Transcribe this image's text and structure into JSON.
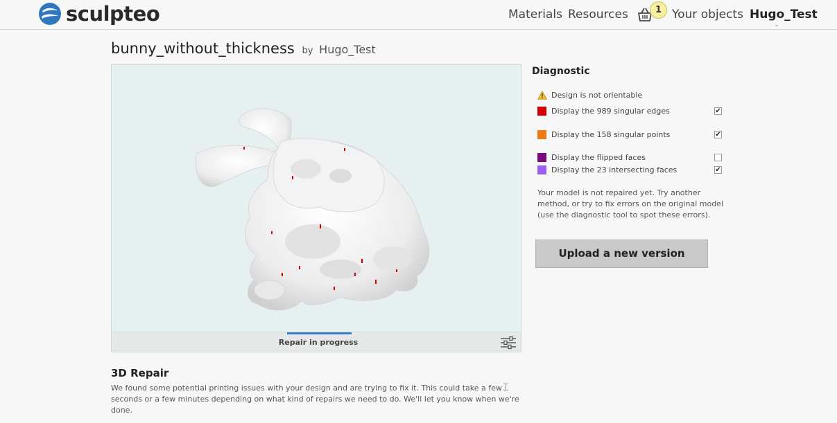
{
  "header": {
    "logo_text": "sculpteo",
    "nav": {
      "materials": "Materials",
      "resources": "Resources",
      "cart_count": "1",
      "your_objects": "Your objects",
      "user": "Hugo_Test"
    }
  },
  "model": {
    "name": "bunny_without_thickness",
    "by": "by",
    "author": "Hugo_Test"
  },
  "viewer": {
    "status": "Repair in progress",
    "progress": 1.0
  },
  "diagnostic": {
    "title": "Diagnostic",
    "warning": "Design is not orientable",
    "items": [
      {
        "label": "Display the 989 singular edges",
        "color": "#d40000",
        "checked": true
      },
      {
        "label": "Display the 158 singular points",
        "color": "#f07814",
        "checked": true
      },
      {
        "label": "Display the flipped faces",
        "color": "#7a0a7a",
        "checked": false
      },
      {
        "label": "Display the 23 intersecting faces",
        "color": "#9a5ff0",
        "checked": true
      }
    ],
    "message": "Your model is not repaired yet. Try another method, or try to fix errors on the original model (use the diagnostic tool to spot these errors).",
    "upload_button": "Upload a new version"
  },
  "repair": {
    "heading": "3D Repair",
    "text": "We found some potential printing issues with your design and are trying to fix it. This could take a few seconds or a few minutes depending on what kind of repairs we need to do. We'll let you know when we're done."
  },
  "colors": {
    "accent": "#3a82c4",
    "viewer_bg": "#e7f0f0",
    "button_bg": "#c9c9c9"
  }
}
